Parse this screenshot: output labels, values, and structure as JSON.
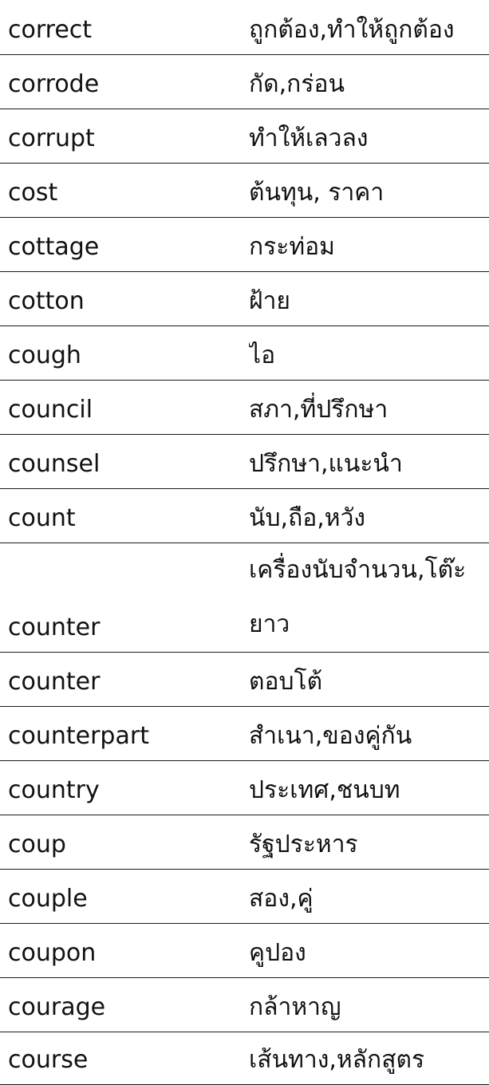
{
  "rows": [
    {
      "word": "correct",
      "meaning": "ถูกต้อง,ทำให้ถูกต้อง"
    },
    {
      "word": "corrode",
      "meaning": "กัด,กร่อน"
    },
    {
      "word": "corrupt",
      "meaning": "ทำให้เลวลง"
    },
    {
      "word": "cost",
      "meaning": "ต้นทุน, ราคา"
    },
    {
      "word": "cottage",
      "meaning": "กระท่อม"
    },
    {
      "word": "cotton",
      "meaning": "ฝ้าย"
    },
    {
      "word": "cough",
      "meaning": "ไอ"
    },
    {
      "word": "council",
      "meaning": "สภา,ที่ปรึกษา"
    },
    {
      "word": "counsel",
      "meaning": "ปรึกษา,แนะนำ"
    },
    {
      "word": "count",
      "meaning": "นับ,ถือ,หวัง"
    },
    {
      "word": "counter",
      "meaning": "เครื่องนับจำนวน,โต๊ะยาว"
    },
    {
      "word": "counter",
      "meaning": "ตอบโต้"
    },
    {
      "word": "counterpart",
      "meaning": "สำเนา,ของคู่กัน"
    },
    {
      "word": "country",
      "meaning": "ประเทศ,ชนบท"
    },
    {
      "word": "coup",
      "meaning": "รัฐประหาร"
    },
    {
      "word": "couple",
      "meaning": "สอง,คู่"
    },
    {
      "word": "coupon",
      "meaning": "คูปอง"
    },
    {
      "word": "courage",
      "meaning": "กล้าหาญ"
    },
    {
      "word": "course",
      "meaning": "เส้นทาง,หลักสูตร"
    }
  ]
}
